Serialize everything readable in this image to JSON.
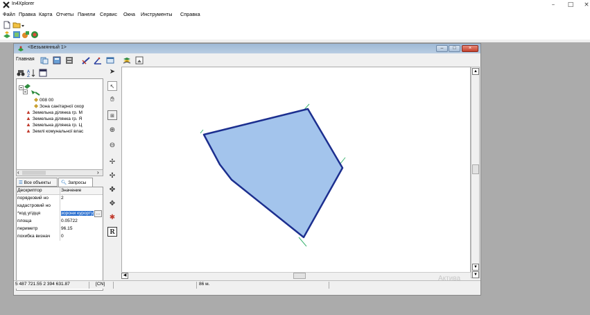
{
  "app": {
    "title": "In4Xplorer",
    "window_controls": [
      "–",
      "□",
      "×"
    ]
  },
  "menu": [
    "Файл",
    "Правка",
    "Карта",
    "Отчеты",
    "Панели",
    "Сервис",
    "Окна",
    "Инструменты",
    "Справка"
  ],
  "child_window": {
    "title": "<Безымянный 1>",
    "toolbar_label": "Главная",
    "buttons": [
      "–",
      "□",
      "×"
    ]
  },
  "tree": {
    "items": [
      {
        "label": "008 00"
      },
      {
        "label": "Зона санітарної охор"
      },
      {
        "label": "Земельна ділянка гр. М"
      },
      {
        "label": "Земельна ділянка гр. Я"
      },
      {
        "label": "Земельна ділянка гр. Ц"
      },
      {
        "label": "Землі комунальної влас"
      }
    ]
  },
  "tabs": {
    "all_objects": "Все объекты",
    "queries": "Запросы"
  },
  "properties": {
    "header_key": "Дескриптор",
    "header_value": "Значение",
    "rows": [
      {
        "key": "порядковий но",
        "value": "2"
      },
      {
        "key": "кадастровий но",
        "value": ""
      },
      {
        "key": "*код угідця",
        "value": "зорони курорту"
      },
      {
        "key": "площа",
        "value": "0.05722"
      },
      {
        "key": "периметр",
        "value": "96.15"
      },
      {
        "key": "похибка визнач",
        "value": "0"
      }
    ]
  },
  "status": {
    "coords": "5 487 721.55  2 394 631.87",
    "crs": "[CN]",
    "scale": "86 м."
  },
  "watermark": "Актива",
  "colors": {
    "polygon_fill": "#a3c4ec",
    "polygon_stroke": "#1c2f8f",
    "guide_line": "#3cb371",
    "mdi_background": "#ababab"
  }
}
